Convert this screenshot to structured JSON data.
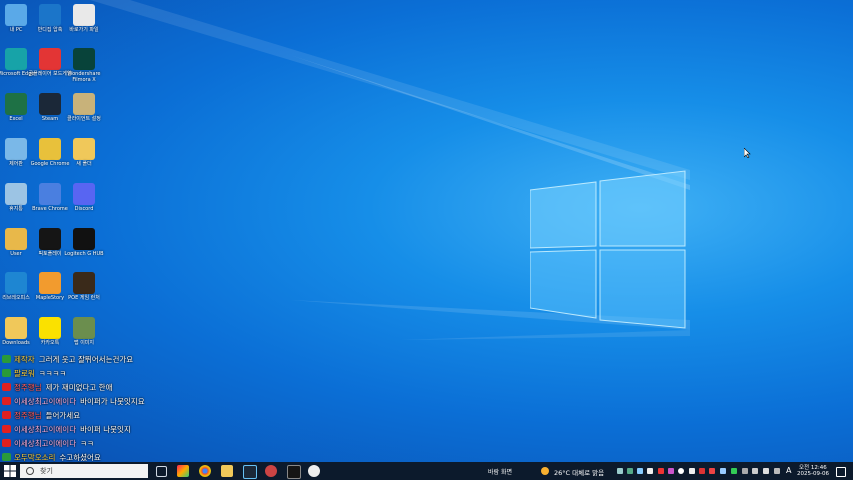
{
  "desktop_icons": [
    {
      "label": "내 PC",
      "color": "#5aa9e8"
    },
    {
      "label": "반디집 압축",
      "color": "#1b75c9"
    },
    {
      "label": "바로가기 파일",
      "color": "#e9e9e9"
    },
    {
      "label": "Microsoft Edge",
      "color": "#17a3a8"
    },
    {
      "label": "곰플레이어 보드게임",
      "color": "#e33535"
    },
    {
      "label": "Wondershare Filmora X",
      "color": "#08433a"
    },
    {
      "label": "Excel",
      "color": "#1e7145"
    },
    {
      "label": "Steam",
      "color": "#1b2838"
    },
    {
      "label": "클라이언트 설정",
      "color": "#c8b27a"
    },
    {
      "label": "제어판",
      "color": "#7ab8e8"
    },
    {
      "label": "Google Chrome",
      "color": "#e8c13b"
    },
    {
      "label": "새 폴더",
      "color": "#f0c85a"
    },
    {
      "label": "휴지통",
      "color": "#9cc4e4"
    },
    {
      "label": "Brave Chrome",
      "color": "#4a7fe0"
    },
    {
      "label": "Discord",
      "color": "#5865f2"
    },
    {
      "label": "User",
      "color": "#e8b84a"
    },
    {
      "label": "픽토플레이",
      "color": "#151515"
    },
    {
      "label": "Logitech G HUB",
      "color": "#111111"
    },
    {
      "label": "리브레오피스",
      "color": "#1e86d2"
    },
    {
      "label": "MapleStory",
      "color": "#f29b2e"
    },
    {
      "label": "POE 게임 런처",
      "color": "#3a2a1a"
    },
    {
      "label": "Downloads",
      "color": "#f0c85a"
    },
    {
      "label": "카카오톡",
      "color": "#fae100"
    },
    {
      "label": "맵 이미지",
      "color": "#6b8e4e"
    }
  ],
  "chat": [
    {
      "name": "제작자",
      "text": "그러게 웃고 잘뛰어서는건가요",
      "name_color": "yellow"
    },
    {
      "name": "팔로워",
      "text": "ㅋㅋㅋㅋ",
      "name_color": "yellow"
    },
    {
      "name": "정주행님",
      "text": "제가 재미없다고 한애",
      "name_color": "red"
    },
    {
      "name": "이세상최고이에이다",
      "text": "바이퍼가 나뭇잇지요",
      "name_color": "pink"
    },
    {
      "name": "정주행님",
      "text": "들어가세요",
      "name_color": "red"
    },
    {
      "name": "이세상최고이에이다",
      "text": "바이퍼 나뭇잇지",
      "name_color": "pink"
    },
    {
      "name": "이세상최고이에이다",
      "text": "ㅋㅋ",
      "name_color": "pink"
    },
    {
      "name": "오두막오소리",
      "text": "수고하셨어요",
      "name_color": "yellow"
    }
  ],
  "taskbar": {
    "search_placeholder": "찾기",
    "weather_left": "바람 화면",
    "weather": "26°C 대체로 맑음",
    "ime": "A",
    "time": "오전 12:46",
    "date": "2025-09-06"
  },
  "colors": {
    "taskbar": "#0c1a2c",
    "desktop_center": "#3fb0f5",
    "desktop_edge": "#0a4fb0"
  }
}
